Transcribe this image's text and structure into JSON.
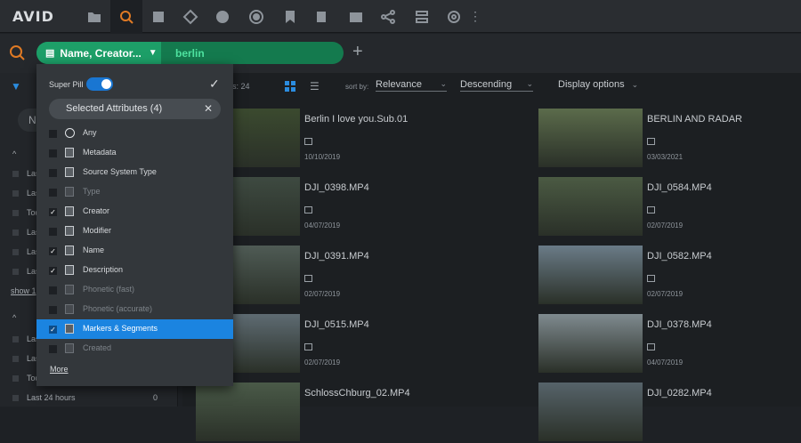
{
  "app": {
    "logo": "AVID"
  },
  "toolbar_icons": [
    "folder-icon",
    "search-icon",
    "edit-icon",
    "connections-icon",
    "person-upload-icon",
    "record-icon",
    "bookmark-icon",
    "export-icon",
    "sequence-icon",
    "share-icon",
    "server-icon",
    "gear-icon",
    "more-icon"
  ],
  "search": {
    "pill_label": "Name, Creator...",
    "pill_value": "berlin",
    "add_symbol": "+"
  },
  "dropdown": {
    "super_pill_label": "Super Pill",
    "super_pill_on": true,
    "selected_attributes_label": "Selected Attributes (4)",
    "more_label": "More",
    "options": [
      {
        "label": "Any",
        "checked": false,
        "dim": false,
        "icon": "circle-icon"
      },
      {
        "label": "Metadata",
        "checked": false,
        "dim": false,
        "icon": "document-icon"
      },
      {
        "label": "Source System Type",
        "checked": false,
        "dim": false,
        "icon": "document-icon"
      },
      {
        "label": "Type",
        "checked": false,
        "dim": true,
        "icon": "document-icon"
      },
      {
        "label": "Creator",
        "checked": true,
        "dim": false,
        "icon": "document-icon"
      },
      {
        "label": "Modifier",
        "checked": false,
        "dim": false,
        "icon": "document-icon"
      },
      {
        "label": "Name",
        "checked": true,
        "dim": false,
        "icon": "document-icon"
      },
      {
        "label": "Description",
        "checked": true,
        "dim": false,
        "icon": "document-icon"
      },
      {
        "label": "Phonetic (fast)",
        "checked": false,
        "dim": true,
        "icon": "speech-icon"
      },
      {
        "label": "Phonetic (accurate)",
        "checked": false,
        "dim": true,
        "icon": "speech-doc-icon"
      },
      {
        "label": "Markers & Segments",
        "checked": true,
        "dim": false,
        "icon": "markers-icon",
        "highlighted": true
      },
      {
        "label": "Created",
        "checked": false,
        "dim": true,
        "icon": "calendar-icon"
      }
    ]
  },
  "sidebar": {
    "input_prefix": "No",
    "lines": [
      "Las",
      "Las",
      "Tod",
      "Las",
      "Las",
      "Las"
    ],
    "show_more": "show 1",
    "lines2": [
      "Las",
      "Las",
      "Tod"
    ],
    "last_line": "Last 24 hours",
    "last_count": "0"
  },
  "results": {
    "count_text": "s: 24",
    "sort_by_label": "sort by:",
    "sort_value": "Relevance",
    "order_value": "Descending",
    "display_options": "Display options"
  },
  "items": [
    {
      "title": "Berlin I love you.Sub.01",
      "date": "10/10/2019",
      "col": 0,
      "row": 0,
      "thumb": "#3b4a2f"
    },
    {
      "title": "BERLIN AND RADAR",
      "date": "03/03/2021",
      "col": 1,
      "row": 0,
      "thumb": "#5b6b4b"
    },
    {
      "title": "DJI_0398.MP4",
      "date": "04/07/2019",
      "col": 0,
      "row": 1,
      "thumb": "#3e4a41"
    },
    {
      "title": "DJI_0584.MP4",
      "date": "02/07/2019",
      "col": 1,
      "row": 1,
      "thumb": "#4b5a43"
    },
    {
      "title": "DJI_0391.MP4",
      "date": "02/07/2019",
      "col": 0,
      "row": 2,
      "thumb": "#4f5b55"
    },
    {
      "title": "DJI_0582.MP4",
      "date": "02/07/2019",
      "col": 1,
      "row": 2,
      "thumb": "#6a7b87"
    },
    {
      "title": "DJI_0515.MP4",
      "date": "02/07/2019",
      "col": 0,
      "row": 3,
      "thumb": "#5e6b72"
    },
    {
      "title": "DJI_0378.MP4",
      "date": "04/07/2019",
      "col": 1,
      "row": 3,
      "thumb": "#7f8a8f"
    },
    {
      "title": "SchlossChburg_02.MP4",
      "date": "",
      "col": 0,
      "row": 4,
      "thumb": "#4a5a48"
    },
    {
      "title": "DJI_0282.MP4",
      "date": "",
      "col": 1,
      "row": 4,
      "thumb": "#56636a"
    }
  ]
}
